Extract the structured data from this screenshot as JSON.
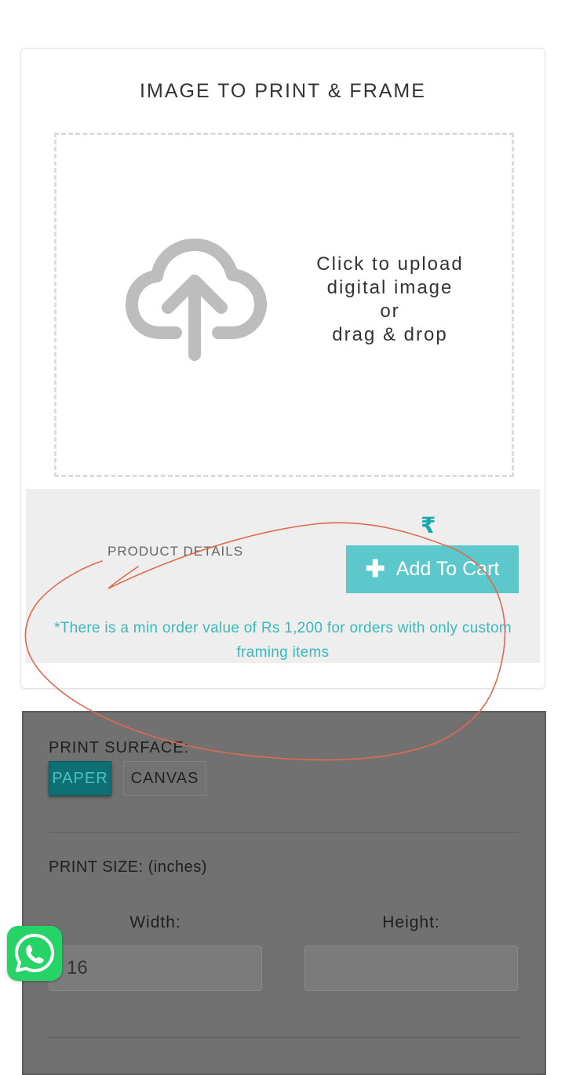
{
  "card": {
    "title": "IMAGE TO PRINT & FRAME",
    "upload": {
      "line1": "Click to upload",
      "line2": "digital image",
      "line3": "or",
      "line4": "drag & drop",
      "icon": "cloud-upload-icon"
    },
    "product_details_label": "PRODUCT DETAILS",
    "currency_symbol": "₹",
    "add_to_cart_label": "Add To Cart",
    "min_order_note": "*There is a min order value of Rs 1,200 for orders with only custom framing items"
  },
  "options": {
    "surface_label": "PRINT SURFACE:",
    "surfaces": [
      "PAPER",
      "CANVAS"
    ],
    "selected_surface": "PAPER",
    "size_label": "PRINT SIZE: (inches)",
    "width_label": "Width:",
    "height_label": "Height:",
    "width_value": "16",
    "height_value": ""
  },
  "whatsapp_icon": "whatsapp-icon",
  "colors": {
    "accent": "#5dc8cb",
    "note_text": "#3ab9bb",
    "selected_surface": "#0f7073",
    "annotation_stroke": "#e06a4f"
  }
}
